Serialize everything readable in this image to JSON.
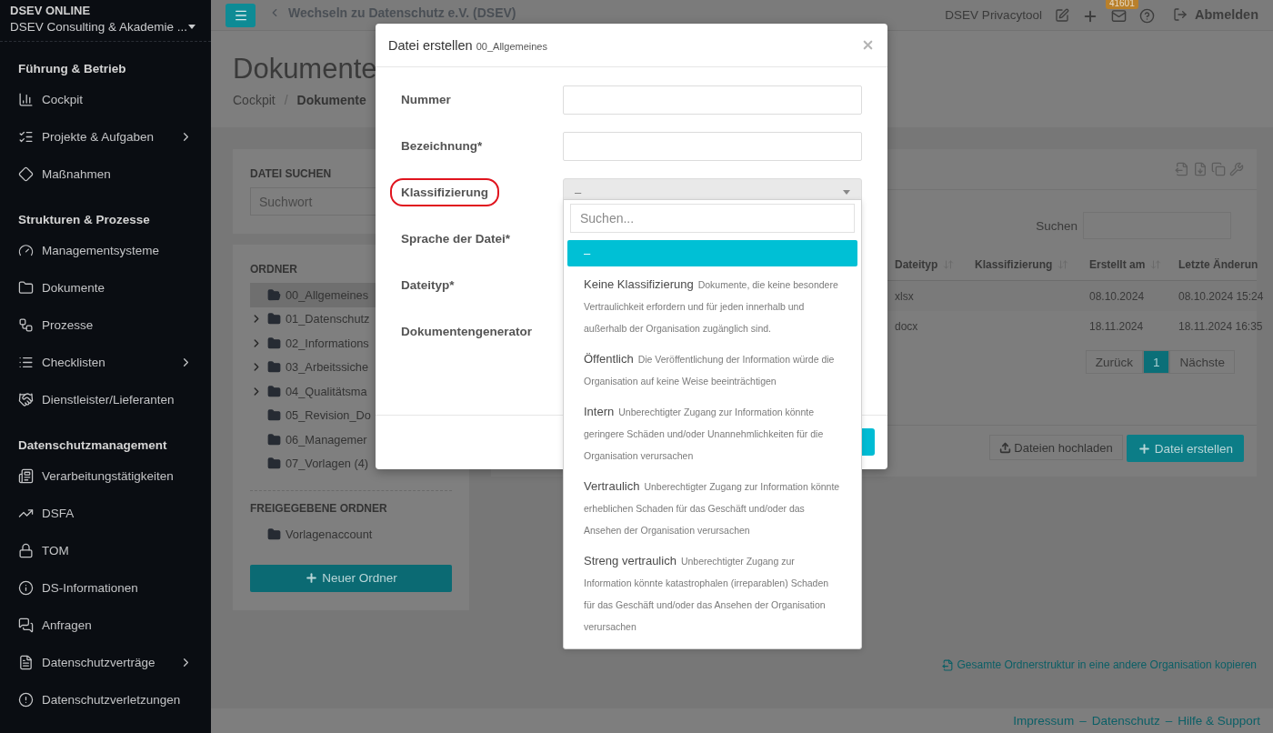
{
  "sidebar": {
    "title": "DSEV ONLINE",
    "organization": "DSEV Consulting & Akademie ...",
    "sections": [
      {
        "heading": "Führung & Betrieb",
        "items": [
          {
            "label": "Cockpit",
            "expandable": false
          },
          {
            "label": "Projekte & Aufgaben",
            "expandable": true
          },
          {
            "label": "Maßnahmen",
            "expandable": false
          }
        ]
      },
      {
        "heading": "Strukturen & Prozesse",
        "items": [
          {
            "label": "Managementsysteme",
            "expandable": false
          },
          {
            "label": "Dokumente",
            "expandable": false
          },
          {
            "label": "Prozesse",
            "expandable": false
          },
          {
            "label": "Checklisten",
            "expandable": true
          },
          {
            "label": "Dienstleister/Lieferanten",
            "expandable": false
          }
        ]
      },
      {
        "heading": "Datenschutzmanagement",
        "items": [
          {
            "label": "Verarbeitungstätigkeiten",
            "expandable": false
          },
          {
            "label": "DSFA",
            "expandable": false
          },
          {
            "label": "TOM",
            "expandable": false
          },
          {
            "label": "DS-Informationen",
            "expandable": false
          },
          {
            "label": "Anfragen",
            "expandable": false
          },
          {
            "label": "Datenschutzverträge",
            "expandable": true
          },
          {
            "label": "Datenschutzverletzungen",
            "expandable": false
          }
        ]
      }
    ]
  },
  "topbar": {
    "back_link": "Wechseln zu Datenschutz e.V. (DSEV)",
    "product": "DSEV Privacytool",
    "mail_badge": "41601",
    "logout": "Abmelden"
  },
  "page": {
    "title": "Dokumente",
    "breadcrumb": [
      {
        "label": "Cockpit",
        "current": false
      },
      {
        "label": "Dokumente",
        "current": true
      }
    ],
    "breadcrumb_separator": "/"
  },
  "file_search": {
    "heading": "DATEI SUCHEN",
    "placeholder": "Suchwort"
  },
  "folders": {
    "heading": "ORDNER",
    "items": [
      {
        "name": "00_Allgemeines",
        "expandable": false,
        "selected": true
      },
      {
        "name": "01_Datenschutz",
        "expandable": true,
        "selected": false
      },
      {
        "name": "02_Informations",
        "expandable": true,
        "selected": false
      },
      {
        "name": "03_Arbeitssiche",
        "expandable": true,
        "selected": false
      },
      {
        "name": "04_Qualitätsma",
        "expandable": true,
        "selected": false
      },
      {
        "name": "05_Revision_Do",
        "expandable": false,
        "selected": false
      },
      {
        "name": "06_Managemer",
        "expandable": false,
        "selected": false
      },
      {
        "name": "07_Vorlagen (4)",
        "expandable": false,
        "selected": false
      }
    ],
    "shared_heading": "FREIGEGEBENE ORDNER",
    "shared": [
      {
        "name": "Vorlagenaccount"
      }
    ],
    "new_button": "Neuer Ordner"
  },
  "files": {
    "search_label": "Suchen",
    "columns": [
      "Dateityp",
      "Klassifizierung",
      "Erstellt am",
      "Letzte Änderun"
    ],
    "rows": [
      {
        "file_type": "xlsx",
        "created": "08.10.2024",
        "modified": "08.10.2024 15:24"
      },
      {
        "file_type": "docx",
        "created": "18.11.2024",
        "modified": "18.11.2024 16:35"
      }
    ],
    "pagination": {
      "previous": "Zurück",
      "pages": [
        {
          "label": "1",
          "selected": true
        }
      ],
      "next": "Nächste"
    },
    "upload_button": "Dateien hochladen",
    "create_button": "Datei erstellen"
  },
  "copy_link": "Gesamte Ordnerstruktur in eine andere Organisation kopieren",
  "footer": {
    "links": [
      "Impressum",
      "Datenschutz",
      "Hilfe & Support"
    ],
    "separator": "–"
  },
  "modal": {
    "title": "Datei erstellen",
    "subtitle": "00_Allgemeines",
    "fields": [
      {
        "label": "Nummer",
        "kind": "text",
        "highlighted": false
      },
      {
        "label": "Bezeichnung*",
        "kind": "text",
        "highlighted": false
      },
      {
        "label": "Klassifizierung",
        "kind": "select",
        "value": "–",
        "highlighted": true
      },
      {
        "label": "Sprache der Datei*",
        "kind": "covered",
        "highlighted": false
      },
      {
        "label": "Dateityp*",
        "kind": "covered",
        "highlighted": false
      },
      {
        "label": "Dokumentengenerator",
        "kind": "covered",
        "highlighted": false
      }
    ],
    "dropdown": {
      "search_placeholder": "Suchen...",
      "options": [
        {
          "label": "–",
          "selected": true
        },
        {
          "label": "Keine Klassifizierung",
          "description": "Dokumente, die keine besondere Vertraulichkeit erfordern und für jeden innerhalb und außerhalb der Organisation zugänglich sind.",
          "selected": false
        },
        {
          "label": "Öffentlich",
          "description": "Die Veröffentlichung der Information würde die Organisation auf keine Weise beeinträchtigen",
          "selected": false
        },
        {
          "label": "Intern",
          "description": "Unberechtigter Zugang zur Information könnte geringere Schäden und/oder Unannehmlichkeiten für die Organisation verursachen",
          "selected": false
        },
        {
          "label": "Vertraulich",
          "description": "Unberechtigter Zugang zur Information könnte erheblichen Schaden für das Geschäft und/oder das Ansehen der Organisation verursachen",
          "selected": false
        },
        {
          "label": "Streng vertraulich",
          "description": "Unberechtigter Zugang zur Information könnte katastrophalen (irreparablen) Schaden für das Geschäft und/oder das Ansehen der Organisation verursachen",
          "selected": false
        }
      ]
    }
  }
}
